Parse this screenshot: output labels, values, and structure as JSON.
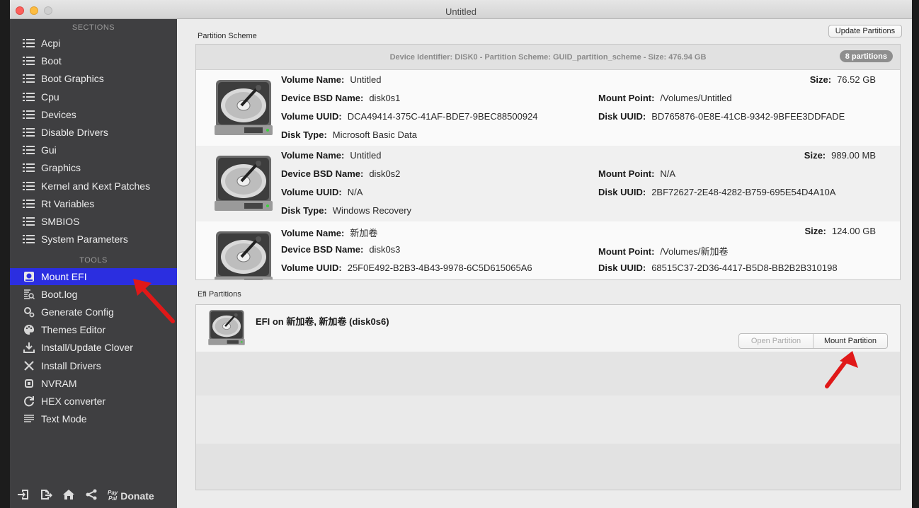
{
  "window": {
    "title": "Untitled"
  },
  "sidebar": {
    "sections_heading": "SECTIONS",
    "sections": [
      {
        "label": "Acpi",
        "icon": "list-icon"
      },
      {
        "label": "Boot",
        "icon": "list-icon"
      },
      {
        "label": "Boot Graphics",
        "icon": "list-icon"
      },
      {
        "label": "Cpu",
        "icon": "list-icon"
      },
      {
        "label": "Devices",
        "icon": "list-icon"
      },
      {
        "label": "Disable Drivers",
        "icon": "list-icon"
      },
      {
        "label": "Gui",
        "icon": "list-icon"
      },
      {
        "label": "Graphics",
        "icon": "list-icon"
      },
      {
        "label": "Kernel and Kext Patches",
        "icon": "list-icon"
      },
      {
        "label": "Rt Variables",
        "icon": "list-icon"
      },
      {
        "label": "SMBIOS",
        "icon": "list-icon"
      },
      {
        "label": "System Parameters",
        "icon": "list-icon"
      }
    ],
    "tools_heading": "TOOLS",
    "tools": [
      {
        "label": "Mount EFI",
        "icon": "disk-icon",
        "active": true
      },
      {
        "label": "Boot.log",
        "icon": "log-search-icon"
      },
      {
        "label": "Generate Config",
        "icon": "gears-icon"
      },
      {
        "label": "Themes Editor",
        "icon": "palette-icon"
      },
      {
        "label": "Install/Update Clover",
        "icon": "download-icon"
      },
      {
        "label": "Install Drivers",
        "icon": "tools-icon"
      },
      {
        "label": "NVRAM",
        "icon": "chip-icon"
      },
      {
        "label": "HEX converter",
        "icon": "refresh-icon"
      },
      {
        "label": "Text Mode",
        "icon": "text-icon"
      }
    ],
    "bottom": {
      "paypal_mark": "Pay Pal",
      "donate_label": "Donate"
    }
  },
  "partition_scheme": {
    "label": "Partition Scheme",
    "update_button": "Update Partitions",
    "header_text": "Device Identifier: DISK0 - Partition Scheme: GUID_partition_scheme - Size: 476.94 GB",
    "count_badge": "8 partitions",
    "labels": {
      "volume_name": "Volume Name:",
      "bsd_name": "Device BSD Name:",
      "volume_uuid": "Volume UUID:",
      "disk_type": "Disk Type:",
      "size": "Size:",
      "mount_point": "Mount Point:",
      "disk_uuid": "Disk UUID:"
    },
    "partitions": [
      {
        "volume_name": "Untitled",
        "bsd_name": "disk0s1",
        "volume_uuid": "DCA49414-375C-41AF-BDE7-9BEC88500924",
        "disk_type": "Microsoft Basic Data",
        "size": "76.52 GB",
        "mount_point": "/Volumes/Untitled",
        "disk_uuid": "BD765876-0E8E-41CB-9342-9BFEE3DDFADE"
      },
      {
        "volume_name": "Untitled",
        "bsd_name": "disk0s2",
        "volume_uuid": "N/A",
        "disk_type": "Windows Recovery",
        "size": "989.00 MB",
        "mount_point": "N/A",
        "disk_uuid": "2BF72627-2E48-4282-B759-695E54D4A10A"
      },
      {
        "volume_name": "新加卷",
        "bsd_name": "disk0s3",
        "volume_uuid": "25F0E492-B2B3-4B43-9978-6C5D615065A6",
        "size": "124.00 GB",
        "mount_point": "/Volumes/新加卷",
        "disk_uuid": "68515C37-2D36-4417-B5D8-BB2B2B310198"
      }
    ]
  },
  "efi": {
    "label": "Efi Partitions",
    "entry_title": "EFI on 新加卷, 新加卷 (disk0s6)",
    "open_button": "Open Partition",
    "mount_button": "Mount Partition"
  },
  "colors": {
    "active": "#2b2ee0",
    "annotation": "#e01818",
    "sidebar": "#3f3f41"
  }
}
